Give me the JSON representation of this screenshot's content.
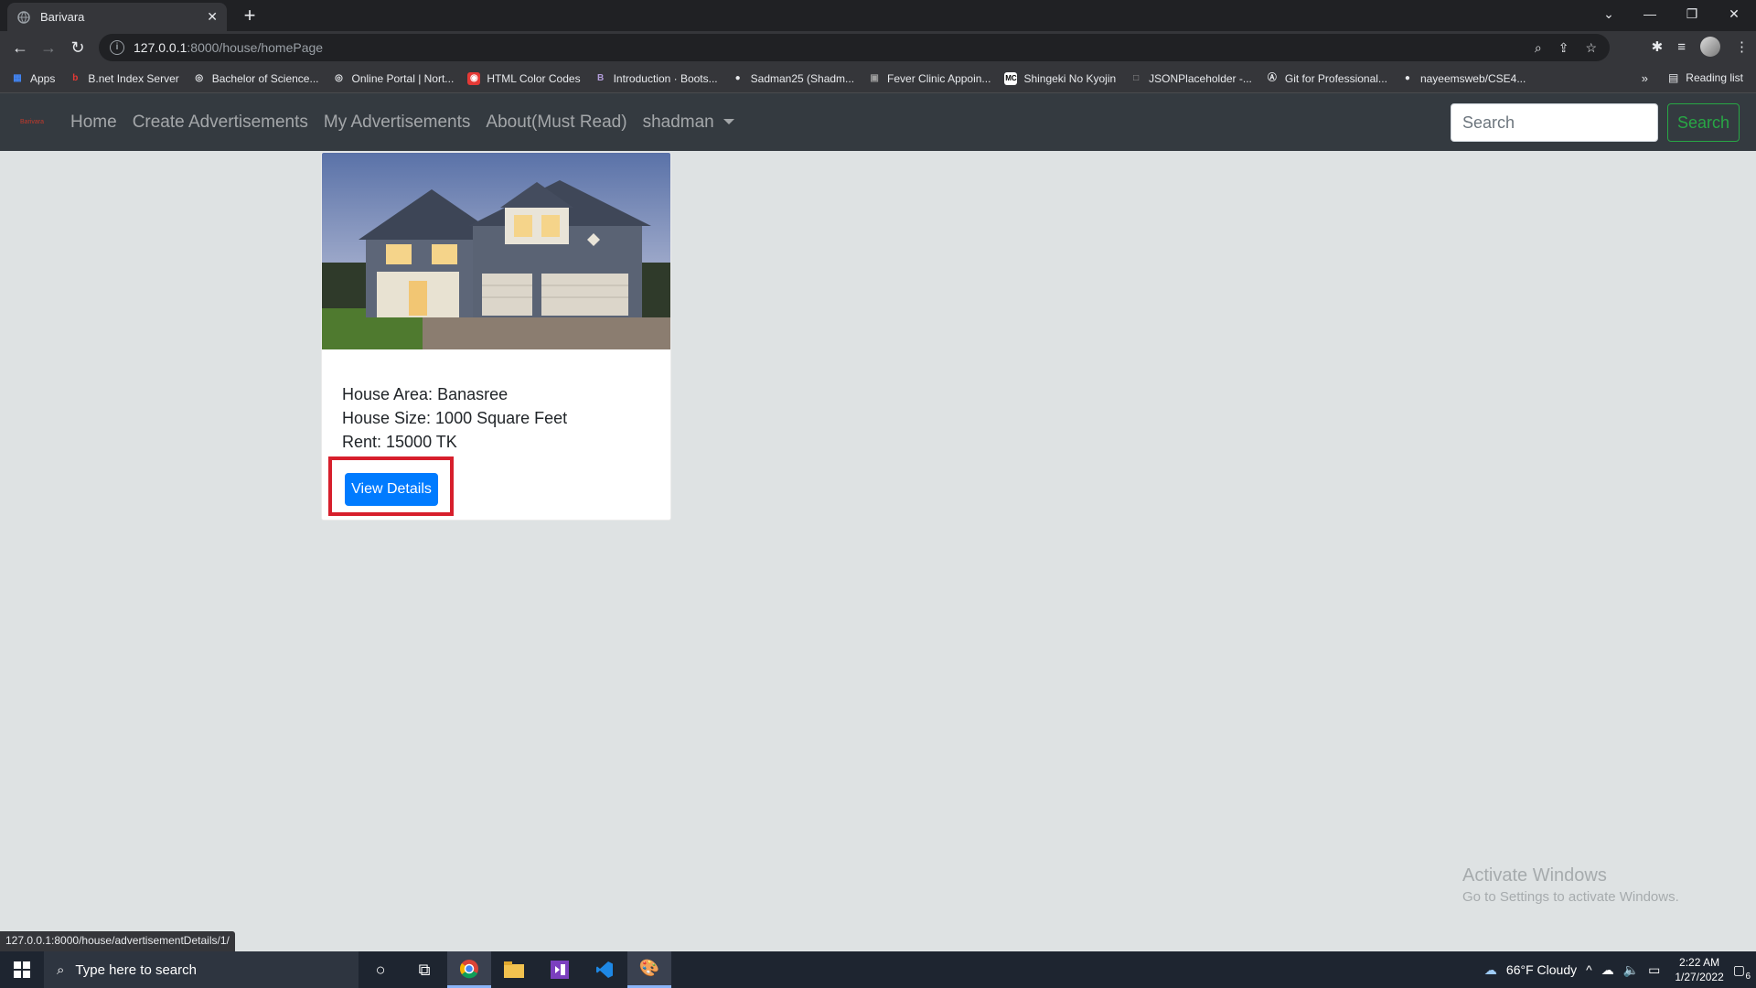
{
  "browser": {
    "tab_title": "Barivara",
    "url_host": "127.0.0.1",
    "url_rest": ":8000/house/homePage",
    "status_url": "127.0.0.1:8000/house/advertisementDetails/1/",
    "reading_list": "Reading list",
    "bookmarks": [
      {
        "label": "Apps",
        "icon": "apps-grid-icon",
        "color": "#4285f4"
      },
      {
        "label": "B.net Index Server",
        "icon": "bnet-icon",
        "color": "#e53935"
      },
      {
        "label": "Bachelor of Science...",
        "icon": "globe-icon",
        "color": "#e8eaed"
      },
      {
        "label": "Online Portal | Nort...",
        "icon": "globe-icon",
        "color": "#e8eaed"
      },
      {
        "label": "HTML Color Codes",
        "icon": "color-codes-icon",
        "color": "#e53935"
      },
      {
        "label": "Introduction · Boots...",
        "icon": "bootstrap-icon",
        "color": "#7952b3"
      },
      {
        "label": "Sadman25 (Shadm...",
        "icon": "github-icon",
        "color": "#e8eaed"
      },
      {
        "label": "Fever Clinic Appoin...",
        "icon": "clinic-icon",
        "color": "#9e9e9e"
      },
      {
        "label": "Shingeki No Kyojin",
        "icon": "mc-icon",
        "color": "#e8eaed"
      },
      {
        "label": "JSONPlaceholder -...",
        "icon": "json-icon",
        "color": "#9e9e9e"
      },
      {
        "label": "Git for Professional...",
        "icon": "git-book-icon",
        "color": "#e8eaed"
      },
      {
        "label": "nayeemsweb/CSE4...",
        "icon": "github-icon",
        "color": "#e8eaed"
      }
    ]
  },
  "navbar": {
    "brand": "Barivara",
    "links": [
      "Home",
      "Create Advertisements",
      "My Advertisements",
      "About(Must Read)"
    ],
    "user": "shadman",
    "search_placeholder": "Search",
    "search_button": "Search"
  },
  "card": {
    "area": "House Area: Banasree",
    "size": "House Size: 1000 Square Feet",
    "rent": "Rent: 15000 TK",
    "button": "View Details"
  },
  "watermark": {
    "line1": "Activate Windows",
    "line2": "Go to Settings to activate Windows."
  },
  "taskbar": {
    "search_placeholder": "Type here to search",
    "weather": "66°F  Cloudy",
    "time": "2:22 AM",
    "date": "1/27/2022",
    "notifications": "6"
  },
  "colors": {
    "navbar_bg": "#343a40",
    "page_bg": "#dee2e3",
    "primary": "#007bff",
    "success": "#28a745",
    "highlight": "#d71f2c"
  }
}
